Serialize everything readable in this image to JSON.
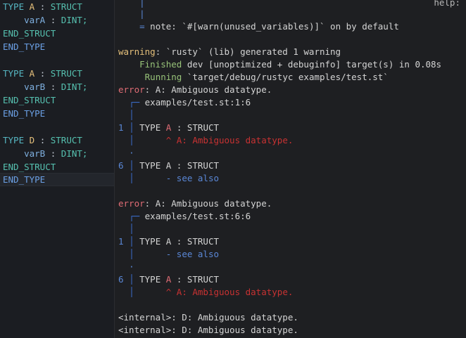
{
  "editor": {
    "blocks": [
      {
        "kw": "TYPE",
        "name": "A",
        "colon": " : ",
        "struct": "STRUCT",
        "var": "varA",
        "vtype": "DINT;",
        "end_struct": "END_STRUCT",
        "end_type": "END_TYPE"
      },
      {
        "kw": "TYPE",
        "name": "A",
        "colon": " : ",
        "struct": "STRUCT",
        "var": "varB",
        "vtype": "DINT;",
        "end_struct": "END_STRUCT",
        "end_type": "END_TYPE"
      },
      {
        "kw": "TYPE",
        "name": "D",
        "colon": " : ",
        "struct": "STRUCT",
        "var": "varB",
        "vtype": "DINT;",
        "end_struct": "END_STRUCT",
        "end_type": "END_TYPE"
      }
    ]
  },
  "terminal": {
    "help_fragment": "help:",
    "pipe": "|",
    "note_eq": "= ",
    "note_text": "note: `#[warn(unused_variables)]` on by default",
    "warning_label": "warning",
    "warning_text": ": `rusty` (lib) generated 1 warning",
    "finished_label": "Finished",
    "finished_text": " dev [unoptimized + debuginfo] target(s) in 0.08s",
    "running_label": "Running",
    "running_text": " `target/debug/rustyc examples/test.st`",
    "error1_label": "error",
    "error1_text": ": A: Ambiguous datatype.",
    "error1_loc": "examples/test.st:1:6",
    "e1_line1_no": "1",
    "e1_line1_pre": "TYPE ",
    "e1_line1_name": "A",
    "e1_line1_post": " : STRUCT",
    "e1_marker1": "^ A: Ambiguous datatype.",
    "dot": "·",
    "e1_line2_no": "6",
    "e1_line2_code": "TYPE A : STRUCT",
    "e1_marker2": "- see also",
    "error2_label": "error",
    "error2_text": ": A: Ambiguous datatype.",
    "error2_loc": "examples/test.st:6:6",
    "e2_line1_no": "1",
    "e2_line1_code": "TYPE A : STRUCT",
    "e2_marker1": "- see also",
    "e2_line2_no": "6",
    "e2_line2_pre": "TYPE ",
    "e2_line2_name": "A",
    "e2_line2_post": " : STRUCT",
    "e2_marker2": "^ A: Ambiguous datatype.",
    "internal1": "<internal>: D: Ambiguous datatype.",
    "internal2": "<internal>: D: Ambiguous datatype."
  },
  "colors": {
    "keyword": "#56b6c2",
    "identifier": "#e5c07b",
    "warning": "#e5c07b",
    "error": "#e06c75",
    "success": "#98c379",
    "gutter": "#5a87d6",
    "marker": "#c83232"
  }
}
